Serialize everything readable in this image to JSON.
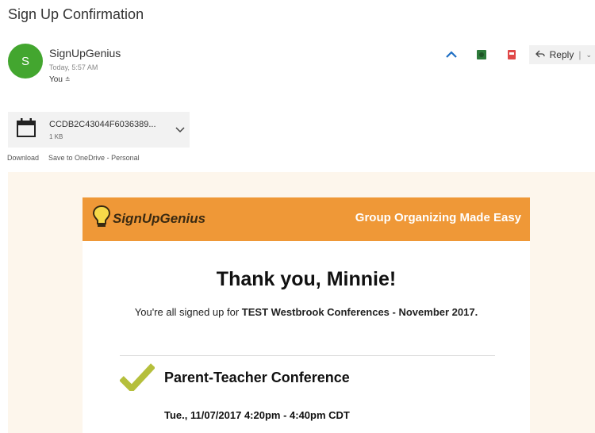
{
  "subject": "Sign Up Confirmation",
  "sender": {
    "avatar_initial": "S",
    "name": "SignUpGenius",
    "time": "Today, 5:57 AM",
    "recipient": "You"
  },
  "toolbar": {
    "reply_label": "Reply"
  },
  "attachment": {
    "filename": "CCDB2C43044F6036389...",
    "size": "1 KB",
    "download_label": "Download",
    "onedrive_label": "Save to OneDrive - Personal"
  },
  "email": {
    "logo_text": "SignUpGenius",
    "tagline": "Group Organizing Made Easy",
    "thanks": "Thank you, Minnie!",
    "signed_prefix": "You're all signed up for ",
    "signed_event": "TEST Westbrook Conferences - November 2017.",
    "event_title": "Parent-Teacher Conference",
    "event_time": "Tue., 11/07/2017 4:20pm - 4:40pm CDT"
  },
  "colors": {
    "avatar": "#43a62f",
    "banner": "#ef9837",
    "check": "#b5bf3c",
    "email_bg": "#fdf6ec"
  }
}
